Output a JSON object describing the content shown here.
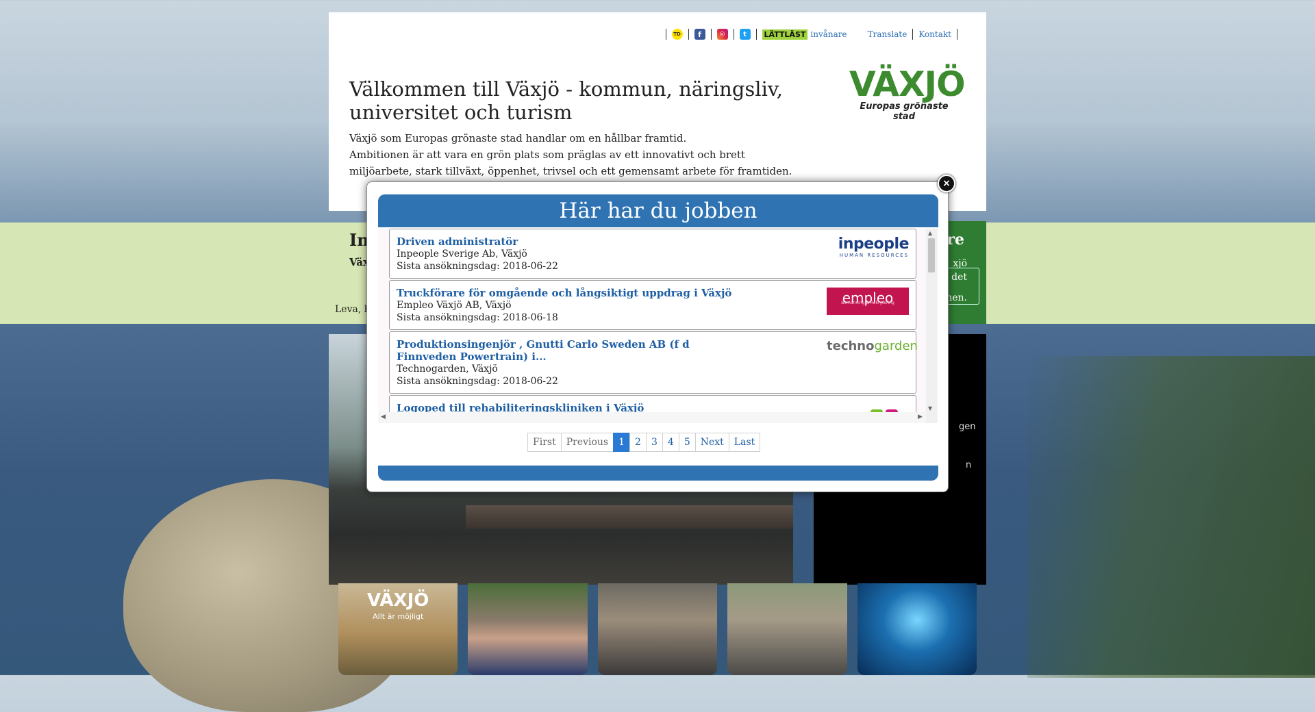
{
  "header": {
    "links": {
      "lattlast_badge": "LÄTTLÄST",
      "invanare": "invånare",
      "translate": "Translate",
      "kontakt": "Kontakt"
    },
    "logo": {
      "main": "VÄXJÖ",
      "sub": "Europas grönaste stad"
    },
    "title": "Välkommen till Växjö - kommun, näringsliv, universitet och turism",
    "intro_line1": "Växjö som Europas grönaste stad handlar om en hållbar framtid.",
    "intro_line2": "Ambitionen är att vara en grön plats som präglas av ett innovativt och brett miljöarbete, stark tillväxt, öppenhet, trivsel och ett gemensamt arbete för framtiden."
  },
  "behind": {
    "heading_fragment": "In",
    "small_fragment": "Väx",
    "leva_fragment": "Leva, b",
    "green_box_title_fragment": "re",
    "green_box_text1": "xjö",
    "green_box_text2": "det",
    "green_box_text3": "nen.",
    "black_link1": "gen",
    "black_link2": "n"
  },
  "thumbs": {
    "t1_title": "VÄXJÖ",
    "t1_sub": "Allt är möjligt"
  },
  "modal": {
    "title": "Här har du jobben",
    "jobs": [
      {
        "title": "Driven administratör",
        "company": "Inpeople Sverige Ab, Växjö",
        "deadline": "Sista ansökningsdag: 2018-06-22",
        "logo_text": "inpeople",
        "logo_sub": "HUMAN RESOURCES"
      },
      {
        "title": "Truckförare för omgående och långsiktigt uppdrag i Växjö",
        "company": "Empleo Växjö AB, Växjö",
        "deadline": "Sista ansökningsdag: 2018-06-18",
        "logo_text": "empleo",
        "logo_sub": "Bemanning & Rekrytering"
      },
      {
        "title": "Produktionsingenjör , Gnutti Carlo Sweden AB (f d Finnveden Powertrain) i...",
        "company": "Technogarden, Växjö",
        "deadline": "Sista ansökningsdag: 2018-06-22",
        "logo_text_a": "techno",
        "logo_text_b": "garden"
      },
      {
        "title": "Logoped till rehabiliteringskliniken i Växjö",
        "company": "",
        "deadline": ""
      }
    ],
    "pagination": {
      "first": "First",
      "previous": "Previous",
      "pages": [
        "1",
        "2",
        "3",
        "4",
        "5"
      ],
      "active_page": "1",
      "next": "Next",
      "last": "Last"
    },
    "close_glyph": "×"
  },
  "colors": {
    "accent_blue": "#2f73b3",
    "link_blue": "#1e5fa3",
    "brand_green": "#3c8b2f",
    "lattlast_green": "#9fd23c",
    "empleo_magenta": "#c21550"
  },
  "icons": [
    "td-icon",
    "facebook-icon",
    "instagram-icon",
    "twitter-icon",
    "close-icon"
  ]
}
